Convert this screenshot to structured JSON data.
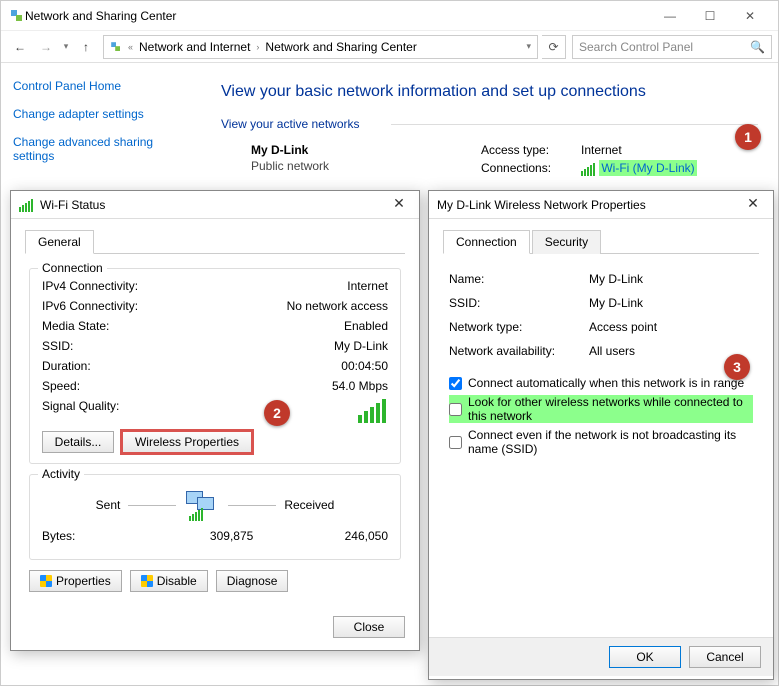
{
  "window": {
    "title": "Network and Sharing Center"
  },
  "nav": {
    "crumb1": "Network and Internet",
    "crumb2": "Network and Sharing Center",
    "search_placeholder": "Search Control Panel"
  },
  "sidebar": {
    "home": "Control Panel Home",
    "adapter": "Change adapter settings",
    "advanced": "Change advanced sharing settings"
  },
  "main": {
    "heading": "View your basic network information and set up connections",
    "active_label": "View your active networks",
    "net_name": "My D-Link",
    "net_type": "Public network",
    "access_label": "Access type:",
    "access_value": "Internet",
    "conn_label": "Connections:",
    "conn_value": "Wi-Fi (My D-Link)"
  },
  "status": {
    "title": "Wi-Fi Status",
    "tab_general": "General",
    "group_conn": "Connection",
    "ipv4_k": "IPv4 Connectivity:",
    "ipv4_v": "Internet",
    "ipv6_k": "IPv6 Connectivity:",
    "ipv6_v": "No network access",
    "media_k": "Media State:",
    "media_v": "Enabled",
    "ssid_k": "SSID:",
    "ssid_v": "My D-Link",
    "dur_k": "Duration:",
    "dur_v": "00:04:50",
    "speed_k": "Speed:",
    "speed_v": "54.0 Mbps",
    "sig_k": "Signal Quality:",
    "btn_details": "Details...",
    "btn_wprops": "Wireless Properties",
    "group_act": "Activity",
    "sent": "Sent",
    "received": "Received",
    "bytes_k": "Bytes:",
    "bytes_sent": "309,875",
    "bytes_recv": "246,050",
    "btn_props": "Properties",
    "btn_disable": "Disable",
    "btn_diag": "Diagnose",
    "btn_close": "Close"
  },
  "props": {
    "title": "My D-Link Wireless Network Properties",
    "tab_conn": "Connection",
    "tab_sec": "Security",
    "name_k": "Name:",
    "name_v": "My D-Link",
    "ssid_k": "SSID:",
    "ssid_v": "My D-Link",
    "type_k": "Network type:",
    "type_v": "Access point",
    "avail_k": "Network availability:",
    "avail_v": "All users",
    "chk1": "Connect automatically when this network is in range",
    "chk2": "Look for other wireless networks while connected to this network",
    "chk3": "Connect even if the network is not broadcasting its name (SSID)",
    "btn_ok": "OK",
    "btn_cancel": "Cancel"
  },
  "markers": {
    "m1": "1",
    "m2": "2",
    "m3": "3"
  }
}
